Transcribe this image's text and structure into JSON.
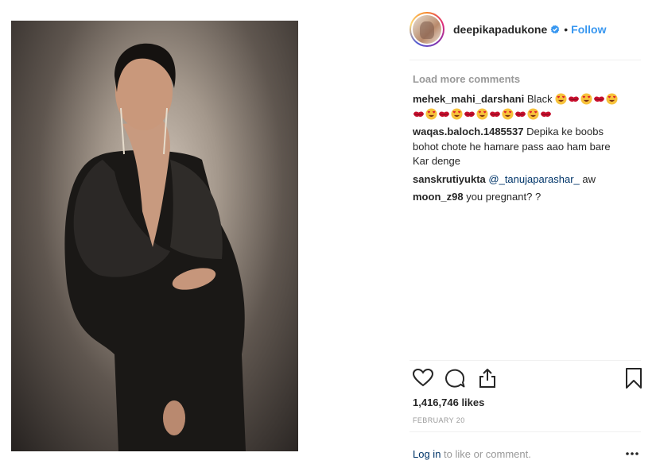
{
  "post": {
    "username": "deepikapadukone",
    "separator": "•",
    "follow_label": "Follow",
    "verified_icon": "verified-badge-icon",
    "brand_blue": "#3897f0"
  },
  "comments": {
    "load_more": "Load more comments",
    "items": [
      {
        "author": "mehek_mahi_darshani",
        "text": "Black",
        "emojis": [
          "heart-eyes",
          "kiss-lips",
          "heart-eyes",
          "kiss-lips",
          "heart-eyes",
          "kiss-lips",
          "heart-eyes",
          "kiss-lips",
          "heart-eyes",
          "kiss-lips",
          "heart-eyes",
          "kiss-lips",
          "heart-eyes",
          "kiss-lips",
          "heart-eyes",
          "kiss-lips"
        ]
      },
      {
        "author": "waqas.baloch.1485537",
        "text": "Depika ke boobs bohot chote he hamare pass aao ham bare Kar denge"
      },
      {
        "author": "sanskrutiyukta",
        "mention": "@_tanujaparashar_",
        "text": " aw"
      },
      {
        "author": "moon_z98",
        "text": "you pregnant? ?"
      }
    ]
  },
  "actions": {
    "like_icon": "heart-icon",
    "comment_icon": "comment-icon",
    "share_icon": "share-icon",
    "save_icon": "bookmark-icon"
  },
  "likes_text": "1,416,746 likes",
  "date_text": "FEBRUARY 20",
  "footer": {
    "login_link": "Log in",
    "login_text": " to like or comment.",
    "more_icon": "more-options-icon"
  }
}
